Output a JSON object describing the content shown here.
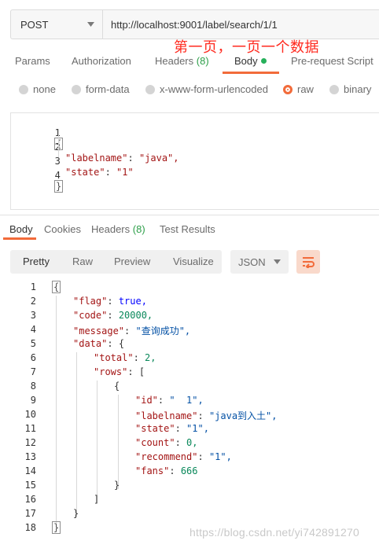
{
  "request": {
    "method": "POST",
    "url": "http://localhost:9001/label/search/1/1"
  },
  "annotation": "第一页，一页一个数据",
  "request_tabs": [
    {
      "label": "Params"
    },
    {
      "label": "Authorization"
    },
    {
      "label": "Headers",
      "count": "(8)"
    },
    {
      "label": "Body"
    },
    {
      "label": "Pre-request Script"
    }
  ],
  "body_types": [
    {
      "label": "none"
    },
    {
      "label": "form-data"
    },
    {
      "label": "x-www-form-urlencoded"
    },
    {
      "label": "raw"
    },
    {
      "label": "binary"
    }
  ],
  "request_body": [
    {
      "n": "1",
      "text": "{"
    },
    {
      "n": "2",
      "key": "\"labelname\"",
      "val": "\"java\","
    },
    {
      "n": "3",
      "key": "\"state\"",
      "val": "\"1\""
    },
    {
      "n": "4",
      "text": "}"
    }
  ],
  "response_tabs": [
    {
      "label": "Body"
    },
    {
      "label": "Cookies"
    },
    {
      "label": "Headers",
      "count": "(8)"
    },
    {
      "label": "Test Results"
    }
  ],
  "view_modes": [
    {
      "label": "Pretty"
    },
    {
      "label": "Raw"
    },
    {
      "label": "Preview"
    },
    {
      "label": "Visualize"
    }
  ],
  "format_select": "JSON",
  "response_body": [
    {
      "n": "1",
      "text": "{"
    },
    {
      "n": "2",
      "key": "\"flag\"",
      "val": "true,"
    },
    {
      "n": "3",
      "key": "\"code\"",
      "val": "20000,"
    },
    {
      "n": "4",
      "key": "\"message\"",
      "val": "\"查询成功\","
    },
    {
      "n": "5",
      "key": "\"data\"",
      "val": "{"
    },
    {
      "n": "6",
      "key": "\"total\"",
      "val": "2,"
    },
    {
      "n": "7",
      "key": "\"rows\"",
      "val": "["
    },
    {
      "n": "8",
      "text": "{"
    },
    {
      "n": "9",
      "key": "\"id\"",
      "val": "\"  1\","
    },
    {
      "n": "10",
      "key": "\"labelname\"",
      "val": "\"java到入土\","
    },
    {
      "n": "11",
      "key": "\"state\"",
      "val": "\"1\","
    },
    {
      "n": "12",
      "key": "\"count\"",
      "val": "0,"
    },
    {
      "n": "13",
      "key": "\"recommend\"",
      "val": "\"1\","
    },
    {
      "n": "14",
      "key": "\"fans\"",
      "val": "666"
    },
    {
      "n": "15",
      "text": "}"
    },
    {
      "n": "16",
      "text": "]"
    },
    {
      "n": "17",
      "text": "}"
    },
    {
      "n": "18",
      "text": "}"
    }
  ],
  "watermark": "https://blog.csdn.net/yi742891270",
  "colors": {
    "accent": "#f26b3a",
    "count_green": "#2e9f4a",
    "annotation_red": "#ff2a1f"
  }
}
